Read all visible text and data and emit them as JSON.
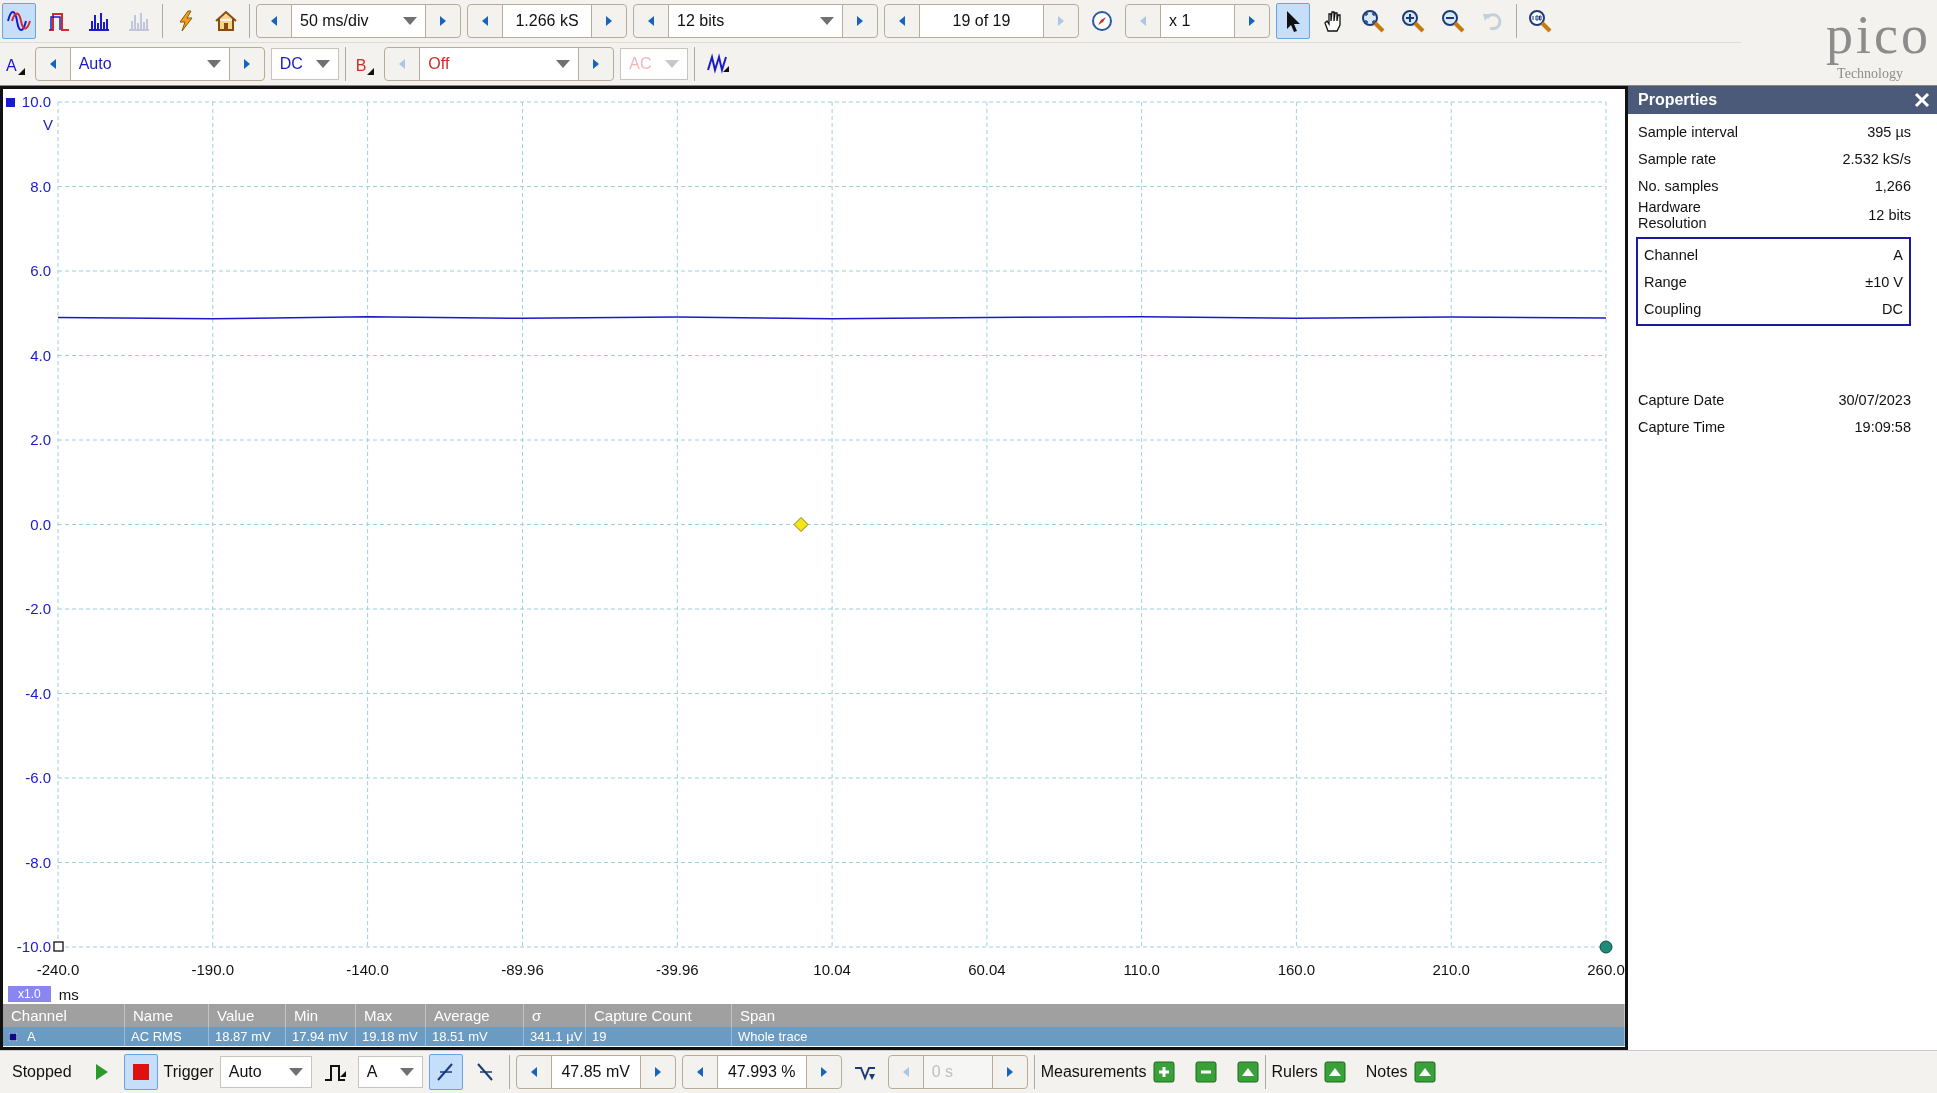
{
  "toolbar": {
    "view_modes": [
      {
        "selected": true,
        "disabled": false
      },
      {
        "selected": false,
        "disabled": false
      },
      {
        "selected": false,
        "disabled": false
      },
      {
        "selected": false,
        "disabled": true
      }
    ],
    "timebase": {
      "value": "50 ms/div"
    },
    "samples": {
      "value": "1.266 kS"
    },
    "resolution": {
      "value": "12 bits"
    },
    "buffer": {
      "value": "19 of 19",
      "prev_disabled": false,
      "next_disabled": true
    },
    "zoom_factor": {
      "value": "x 1",
      "prev_disabled": true,
      "next_disabled": false
    },
    "tools": [
      {
        "selected": true,
        "disabled": false
      },
      {
        "selected": false,
        "disabled": false
      },
      {
        "selected": false,
        "disabled": false
      },
      {
        "selected": false,
        "disabled": false
      },
      {
        "selected": false,
        "disabled": false
      },
      {
        "selected": false,
        "disabled": true
      }
    ]
  },
  "logo": {
    "name": "pico",
    "tagline": "Technology"
  },
  "channels": [
    {
      "label": "A",
      "color": "#1a1acc",
      "range": "Auto",
      "coupling": "DC",
      "enabled": true
    },
    {
      "label": "B",
      "color": "#d42a2a",
      "range": "Off",
      "coupling": "AC",
      "enabled": false
    }
  ],
  "chart_data": {
    "type": "line",
    "xlabel": "ms",
    "ylabel": "V",
    "xlim": [
      -240,
      260
    ],
    "ylim": [
      -10,
      10
    ],
    "xticks": [
      {
        "value": -240,
        "label": "-240.0"
      },
      {
        "value": -190,
        "label": "-190.0"
      },
      {
        "value": -140,
        "label": "-140.0"
      },
      {
        "value": -89.96,
        "label": "-89.96"
      },
      {
        "value": -39.96,
        "label": "-39.96"
      },
      {
        "value": 10.04,
        "label": "10.04"
      },
      {
        "value": 60.04,
        "label": "60.04"
      },
      {
        "value": 110,
        "label": "110.0"
      },
      {
        "value": 160,
        "label": "160.0"
      },
      {
        "value": 210,
        "label": "210.0"
      },
      {
        "value": 260,
        "label": "260.0"
      }
    ],
    "yticks": [
      {
        "value": 10,
        "label": "10.0"
      },
      {
        "value": 8,
        "label": "8.0"
      },
      {
        "value": 6,
        "label": "6.0"
      },
      {
        "value": 4,
        "label": "4.0"
      },
      {
        "value": 2,
        "label": "2.0"
      },
      {
        "value": 0,
        "label": "0.0"
      },
      {
        "value": -2,
        "label": "-2.0"
      },
      {
        "value": -4,
        "label": "-4.0"
      },
      {
        "value": -6,
        "label": "-6.0"
      },
      {
        "value": -8,
        "label": "-8.0"
      },
      {
        "value": -10,
        "label": "-10.0"
      }
    ],
    "x": [
      -240,
      -190,
      -140,
      -90,
      -40,
      10,
      60,
      110,
      160,
      210,
      260
    ],
    "grid": true,
    "series": [
      {
        "color": "#1a1acc",
        "values": [
          4.9,
          4.87,
          4.92,
          4.88,
          4.91,
          4.87,
          4.9,
          4.92,
          4.88,
          4.91,
          4.89
        ]
      }
    ]
  },
  "x_zoom_badge": "x1.0",
  "properties": {
    "title": "Properties",
    "rows": [
      {
        "label": "Sample interval",
        "value": "395 µs"
      },
      {
        "label": "Sample rate",
        "value": "2.532 kS/s"
      },
      {
        "label": "No. samples",
        "value": "1,266"
      },
      {
        "label": "Hardware Resolution",
        "value": "12 bits"
      }
    ],
    "channel_rows": [
      {
        "label": "Channel",
        "value": "A"
      },
      {
        "label": "Range",
        "value": "±10 V"
      },
      {
        "label": "Coupling",
        "value": "DC"
      }
    ],
    "capture_rows": [
      {
        "label": "Capture Date",
        "value": "30/07/2023"
      },
      {
        "label": "Capture Time",
        "value": "19:09:58"
      }
    ]
  },
  "measurements": {
    "columns": [
      "Channel",
      "Name",
      "Value",
      "Min",
      "Max",
      "Average",
      "σ",
      "Capture Count",
      "Span"
    ],
    "rows": [
      {
        "selected": true,
        "cells": [
          "A",
          "AC RMS",
          "18.87 mV",
          "17.94 mV",
          "19.18 mV",
          "18.51 mV",
          "341.1 µV",
          "19",
          "Whole trace"
        ]
      }
    ]
  },
  "status_bar": {
    "run_state": "Stopped",
    "run_buttons": [
      {
        "selected": false
      },
      {
        "selected": true
      }
    ],
    "trigger_label": "Trigger",
    "trigger_mode": "Auto",
    "trigger_source": "A",
    "edges": [
      {
        "selected": true
      },
      {
        "selected": false
      }
    ],
    "threshold": "47.85 mV",
    "pre_trigger": "47.993 %",
    "delay": {
      "value": "0 s",
      "disabled": true
    },
    "measurements_label": "Measurements",
    "rulers_label": "Rulers",
    "notes_label": "Notes"
  }
}
